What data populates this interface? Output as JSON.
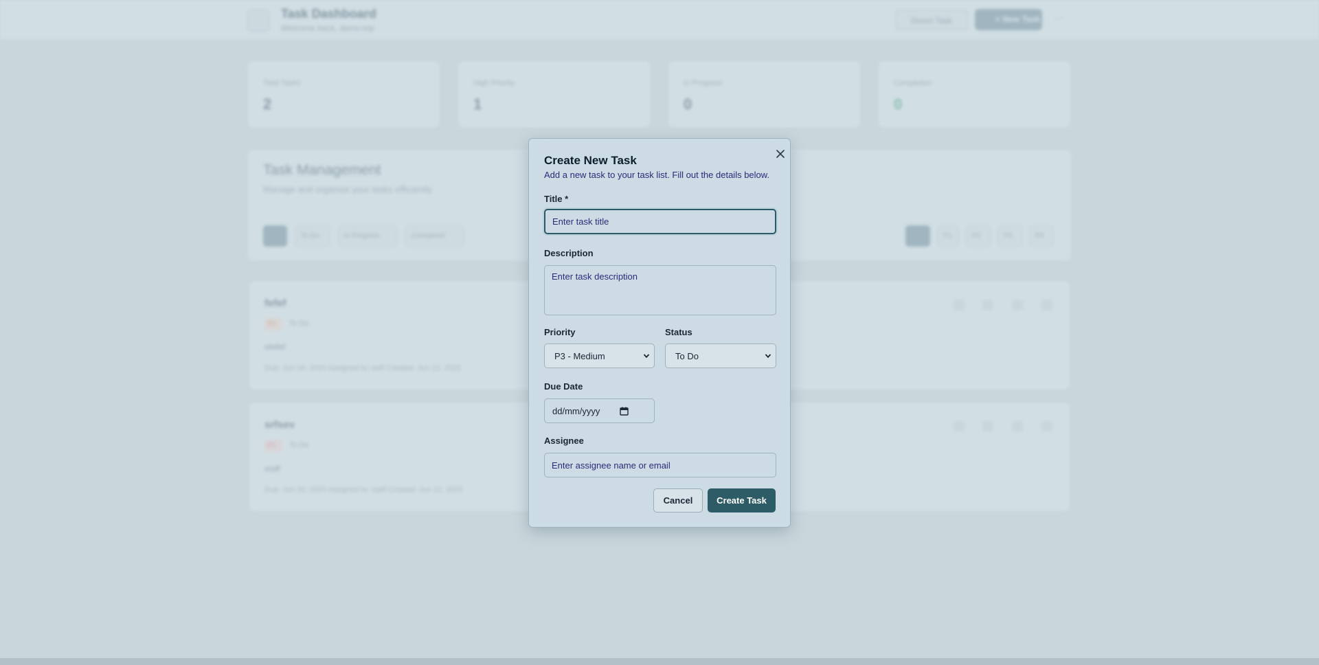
{
  "background": {
    "header": {
      "title": "Task Dashboard",
      "subtitle": "Welcome back, demo-trip",
      "secondary_button": "Demo Task",
      "new_task_button": "+ New Task",
      "more_label": "⋯"
    },
    "stats": [
      {
        "label": "Total Tasks",
        "value": "2"
      },
      {
        "label": "High Priority",
        "value": "1"
      },
      {
        "label": "In Progress",
        "value": "0"
      },
      {
        "label": "Completion",
        "value": "0"
      }
    ],
    "management": {
      "title": "Task Management",
      "subtitle": "Manage and organize your tasks efficiently",
      "status_filters": [
        "All",
        "To Do",
        "In Progress",
        "Completed"
      ],
      "priority_filters": [
        "All",
        "P1",
        "P2",
        "P3",
        "P4"
      ]
    },
    "tasks": [
      {
        "title": "fefef",
        "priority": "P3",
        "status": "To Do",
        "description": "efefef",
        "meta": "Due: Jun 04, 2025    Assigned to: eeff    Created: Jun 12, 2025"
      },
      {
        "title": "srfsev",
        "priority": "P1",
        "status": "To Do",
        "description": "esdf",
        "meta": "Due: Jun 20, 2025    Assigned to: sadf    Created: Jun 12, 2025"
      }
    ]
  },
  "modal": {
    "title": "Create New Task",
    "description": "Add a new task to your task list. Fill out the details below.",
    "close_icon": "close-icon",
    "fields": {
      "title_label": "Title *",
      "title_placeholder": "Enter task title",
      "description_label": "Description",
      "description_placeholder": "Enter task description",
      "priority_label": "Priority",
      "priority_value": "P3 - Medium",
      "status_label": "Status",
      "status_value": "To Do",
      "due_date_label": "Due Date",
      "due_date_value": "dd/mm/yyyy",
      "assignee_label": "Assignee",
      "assignee_placeholder": "Enter assignee name or email"
    },
    "cancel_label": "Cancel",
    "create_label": "Create Task"
  },
  "colors": {
    "primary": "#2d5c66",
    "overlay": "#c9d7dd",
    "modal_bg": "#cddce4",
    "placeholder_text": "#2c2a7a"
  }
}
